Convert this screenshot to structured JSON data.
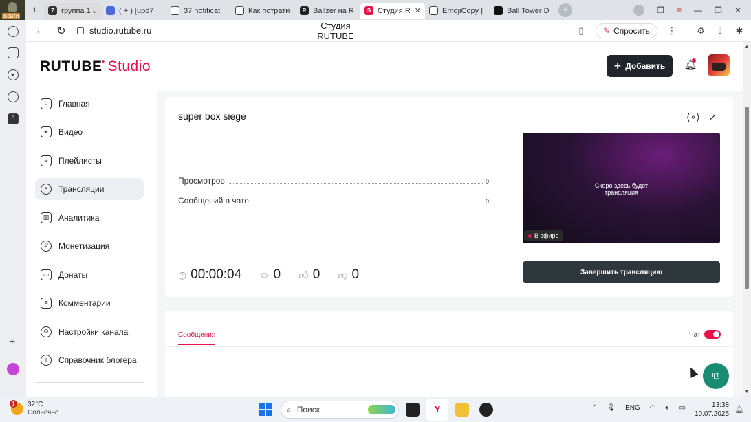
{
  "browser": {
    "profile_label": "Войти",
    "tab_count": "1",
    "tabs": [
      {
        "label": "группа 1",
        "favicon": "7"
      },
      {
        "label": "( + ) [upd7",
        "favicon": ""
      },
      {
        "label": "37 notificati",
        "favicon": ""
      },
      {
        "label": "Как потрати",
        "favicon": ""
      },
      {
        "label": "Ballzer на R",
        "favicon": "R"
      },
      {
        "label": "Студия R",
        "favicon": "S"
      },
      {
        "label": "EmojiCopy |",
        "favicon": ""
      },
      {
        "label": "Ball Tower D",
        "favicon": ""
      }
    ],
    "url": "studio.rutube.ru",
    "page_title": "Студия RUTUBE",
    "ask_label": "Спросить"
  },
  "app": {
    "logo_main": "RUTUBE",
    "logo_sub": "Studio",
    "add_button": "Добавить",
    "accent_color": "#e5134a"
  },
  "nav": {
    "items": [
      {
        "label": "Главная",
        "icon": "home-icon"
      },
      {
        "label": "Видео",
        "icon": "video-icon"
      },
      {
        "label": "Плейлисты",
        "icon": "playlist-icon"
      },
      {
        "label": "Трансляции",
        "icon": "broadcast-icon"
      },
      {
        "label": "Аналитика",
        "icon": "analytics-icon"
      },
      {
        "label": "Монетизация",
        "icon": "ruble-icon"
      },
      {
        "label": "Донаты",
        "icon": "donate-icon"
      },
      {
        "label": "Комментарии",
        "icon": "comments-icon"
      },
      {
        "label": "Настройки канала",
        "icon": "gear-icon"
      },
      {
        "label": "Справочник блогера",
        "icon": "info-icon"
      }
    ],
    "active": "Трансляции"
  },
  "stream": {
    "title": "super box siege",
    "stats": [
      {
        "label": "Просмотров",
        "value": "0"
      },
      {
        "label": "Сообщений в чате",
        "value": "0"
      }
    ],
    "preview_text_1": "Скоро здесь будет",
    "preview_text_2": "трансляция",
    "live_badge": "В эфире",
    "end_button": "Завершить трансляцию",
    "timer": "00:00:04",
    "viewers": "0",
    "likes": "0",
    "dislikes": "0"
  },
  "chat": {
    "tab_label": "Сообщения",
    "chat_label": "Чат",
    "chat_enabled": true
  },
  "taskbar": {
    "weather_temp": "32°C",
    "weather_desc": "Солнечно",
    "weather_badge": "1",
    "search_label": "Поиск",
    "lang": "ENG",
    "time": "13:38",
    "date": "10.07.2025"
  }
}
